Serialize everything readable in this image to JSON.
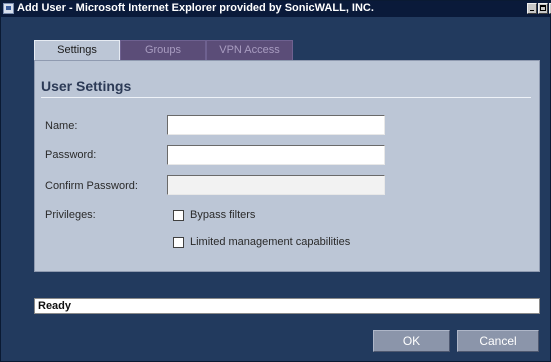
{
  "window": {
    "title": "Add User - Microsoft Internet Explorer provided by SonicWALL, INC."
  },
  "tabs": [
    {
      "label": "Settings",
      "active": true
    },
    {
      "label": "Groups",
      "active": false
    },
    {
      "label": "VPN Access",
      "active": false
    }
  ],
  "section": {
    "title": "User Settings"
  },
  "form": {
    "name_label": "Name:",
    "name_value": "",
    "password_label": "Password:",
    "password_value": "",
    "confirm_label": "Confirm Password:",
    "confirm_value": "",
    "privileges_label": "Privileges:",
    "bypass_label": "Bypass filters",
    "bypass_checked": false,
    "limited_label": "Limited management capabilities",
    "limited_checked": false
  },
  "status": {
    "text": "Ready"
  },
  "buttons": {
    "ok_label": "OK",
    "cancel_label": "Cancel"
  },
  "colors": {
    "background": "#223a5e",
    "panel": "#bcc6d6",
    "inactive_tab": "#5b4d78",
    "button": "#8b95aa"
  }
}
